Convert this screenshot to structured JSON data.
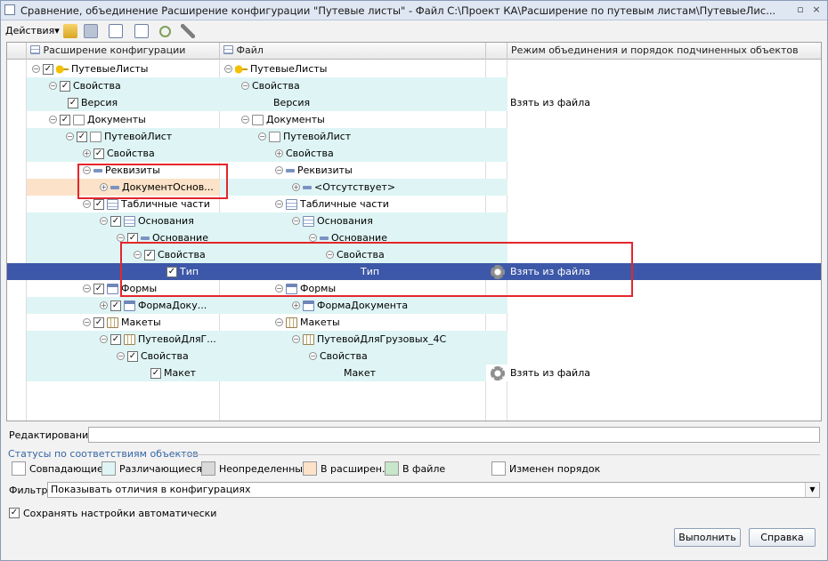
{
  "window": {
    "title": "Сравнение, объединение Расширение конфигурации \"Путевые листы\" - Файл C:\\Проект КА\\Расширение по путевым листам\\ПутевыеЛис...",
    "controls": {
      "close": "×"
    }
  },
  "toolbar": {
    "actions_label": "Действия",
    "dropdown_glyph": "▾"
  },
  "grid": {
    "headers": {
      "col1": "Расширение конфигурации",
      "col2": "Файл",
      "col3": "Режим объединения и порядок подчиненных объектов"
    },
    "rows": [
      {
        "c1": "ПутевыеЛисты",
        "c2": "ПутевыеЛисты",
        "c3": ""
      },
      {
        "c1": "Свойства",
        "c2": "Свойства",
        "c3": ""
      },
      {
        "c1": "Версия",
        "c2": "Версия",
        "c3": "Взять из файла"
      },
      {
        "c1": "Документы",
        "c2": "Документы",
        "c3": ""
      },
      {
        "c1": "ПутевойЛист",
        "c2": "ПутевойЛист",
        "c3": ""
      },
      {
        "c1": "Свойства",
        "c2": "Свойства",
        "c3": ""
      },
      {
        "c1": "Реквизиты",
        "c2": "Реквизиты",
        "c3": ""
      },
      {
        "c1": "ДокументОснов...",
        "c2": "<Отсутствует>",
        "c3": ""
      },
      {
        "c1": "Табличные части",
        "c2": "Табличные части",
        "c3": ""
      },
      {
        "c1": "Основания",
        "c2": "Основания",
        "c3": ""
      },
      {
        "c1": "Основание",
        "c2": "Основание",
        "c3": ""
      },
      {
        "c1": "Свойства",
        "c2": "Свойства",
        "c3": ""
      },
      {
        "c1": "Тип",
        "c2": "Тип",
        "c3": "Взять из файла"
      },
      {
        "c1": "Формы",
        "c2": "Формы",
        "c3": ""
      },
      {
        "c1": "ФормаДоку...",
        "c2": "ФормаДокумента",
        "c3": ""
      },
      {
        "c1": "Макеты",
        "c2": "Макеты",
        "c3": ""
      },
      {
        "c1": "ПутевойДляГ...",
        "c2": "ПутевойДляГрузовых_4С",
        "c3": ""
      },
      {
        "c1": "Свойства",
        "c2": "Свойства",
        "c3": ""
      },
      {
        "c1": "Макет",
        "c2": "Макет",
        "c3": "Взять из файла"
      }
    ]
  },
  "editing": {
    "label": "Редактирование:",
    "value": ""
  },
  "statuses": {
    "title": "Статусы по соответствиям объектов",
    "items": [
      {
        "label": "Совпадающие",
        "color": "#ffffff"
      },
      {
        "label": "Различающиеся",
        "color": "#dff5f5"
      },
      {
        "label": "Неопределенные",
        "color": "#d9d9d9"
      },
      {
        "label": "В расширен...",
        "color": "#fbe2c8"
      },
      {
        "label": "В файле",
        "color": "#c8e6c9"
      },
      {
        "label": "Изменен порядок",
        "color": "#ffffff"
      }
    ]
  },
  "filter": {
    "label": "Фильтр:",
    "value": "Показывать отличия в конфигурациях",
    "dropdown_glyph": "▼"
  },
  "autosave": {
    "label": "Сохранять настройки автоматически",
    "checked": true,
    "mark": "✓"
  },
  "buttons": {
    "run": "Выполнить",
    "help": "Справка"
  },
  "accent_colors": {
    "selection": "#3d58a8",
    "highlight_box": "#e4262c"
  }
}
